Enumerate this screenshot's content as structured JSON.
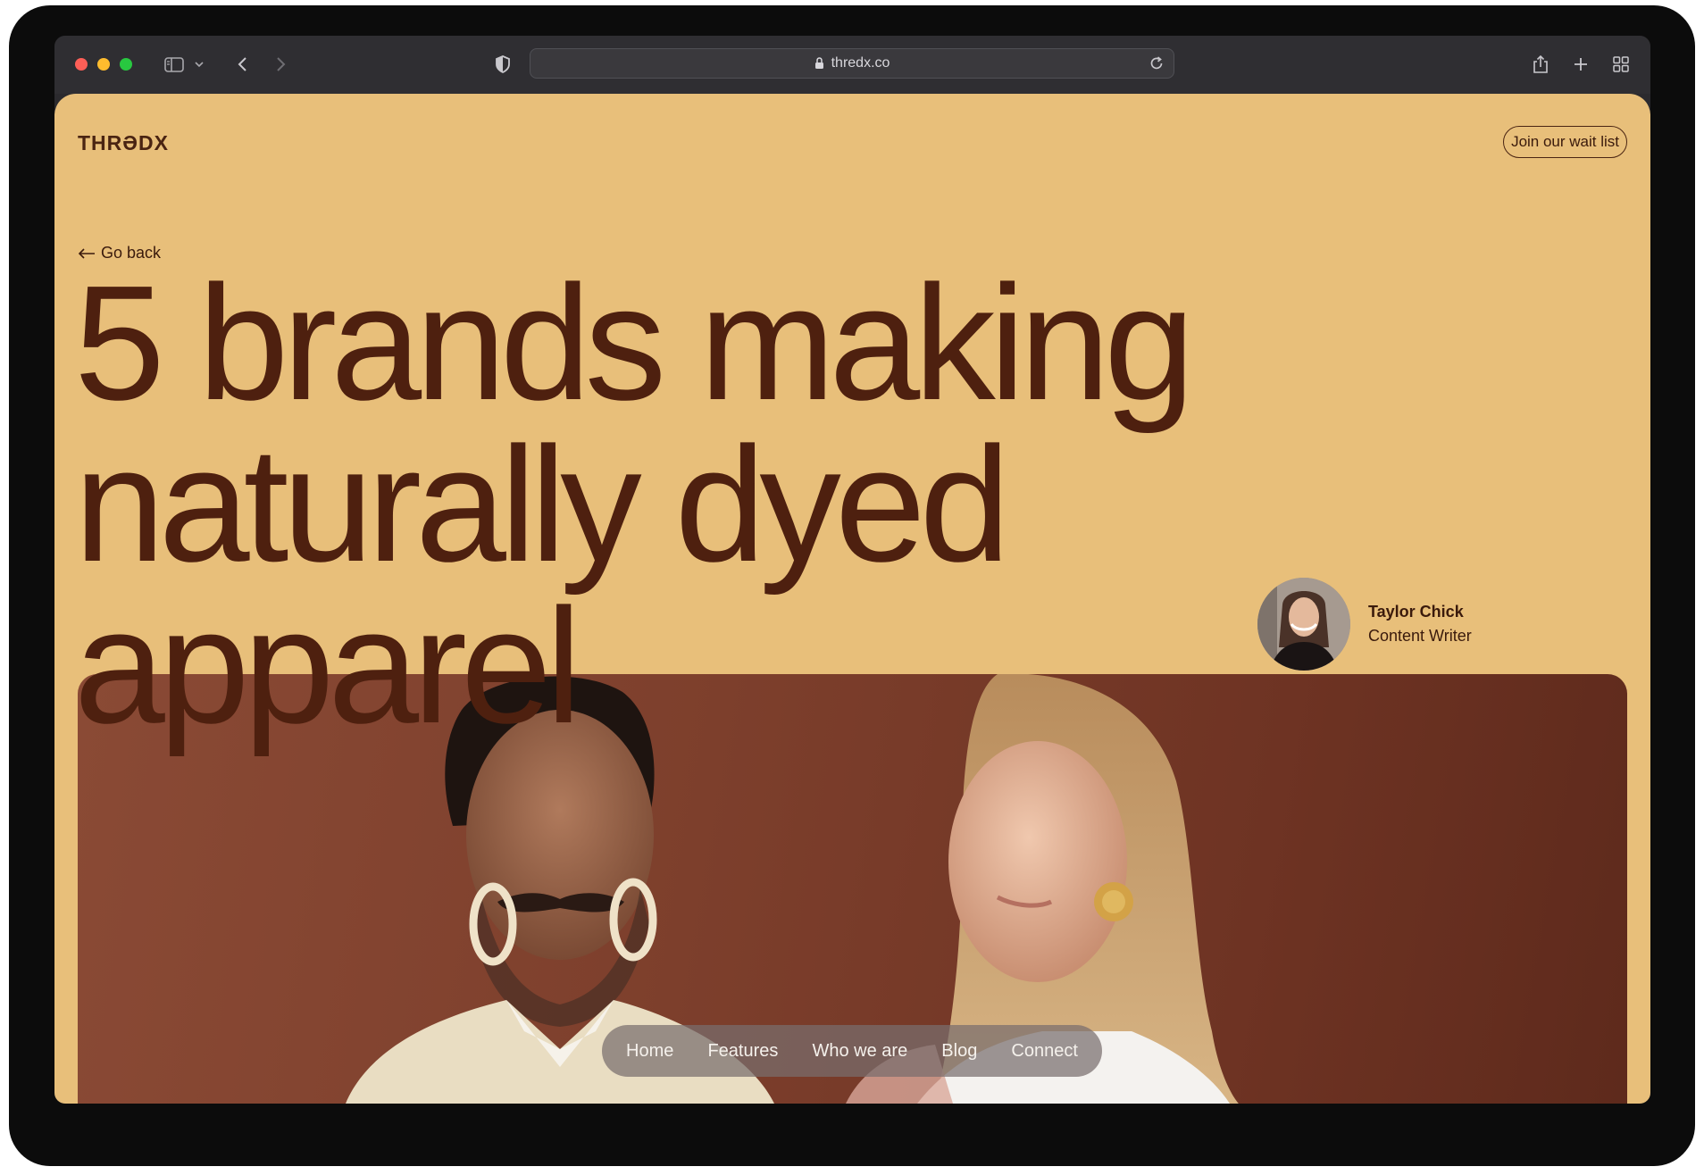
{
  "browser": {
    "url": "thredx.co"
  },
  "site": {
    "logo": "THRƏDX",
    "waitlist_label": "Join our wait list",
    "go_back_label": "Go back"
  },
  "article": {
    "title_lines": [
      "5 brands making",
      "naturally dyed",
      "apparel"
    ],
    "author_name": "Taylor Chick",
    "author_role": "Content Writer"
  },
  "nav": {
    "items": [
      "Home",
      "Features",
      "Who we are",
      "Blog",
      "Connect"
    ]
  },
  "colors": {
    "page_bg": "#e8bf7a",
    "headline": "#4e200f",
    "photo_bg": "#7d3f2c"
  },
  "icons": [
    "sidebar-icon",
    "chevron-down-icon",
    "back-icon",
    "forward-icon",
    "shield-icon",
    "lock-icon",
    "reload-icon",
    "share-icon",
    "plus-icon",
    "tab-overview-icon",
    "arrow-left-icon"
  ]
}
